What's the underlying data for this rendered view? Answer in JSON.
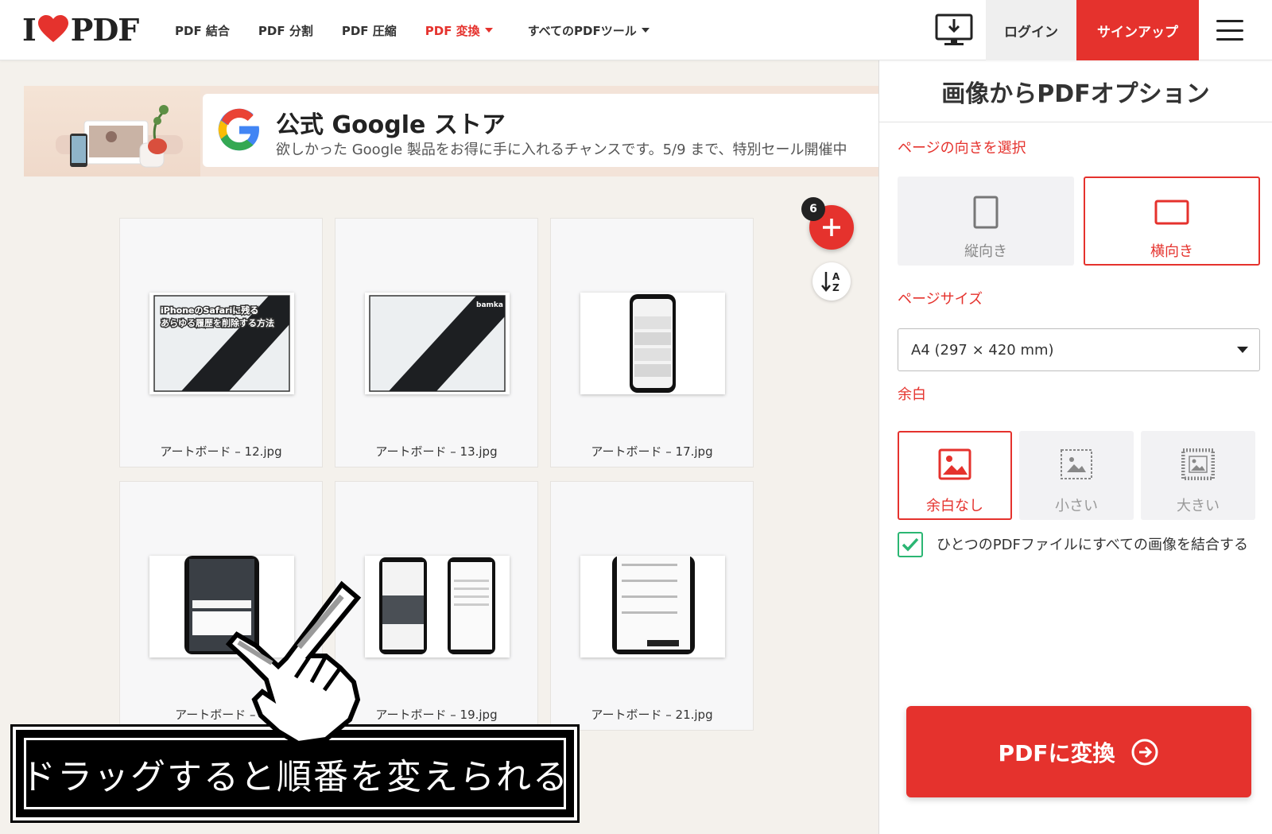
{
  "header": {
    "logo_text": "PDF",
    "logo_prefix": "I",
    "nav": [
      {
        "label": "PDF 結合",
        "active": false,
        "dropdown": false
      },
      {
        "label": "PDF 分割",
        "active": false,
        "dropdown": false
      },
      {
        "label": "PDF 圧縮",
        "active": false,
        "dropdown": false
      },
      {
        "label": "PDF 変換",
        "active": true,
        "dropdown": true
      },
      {
        "label": "すべてのPDFツール",
        "active": false,
        "dropdown": true
      }
    ],
    "desktop_icon": "desktop-download-icon",
    "login_label": "ログイン",
    "signup_label": "サインアップ",
    "menu_icon": "hamburger-menu-icon"
  },
  "ad": {
    "title": "公式 Google ストア",
    "subtitle": "欲しかった Google 製品をお得に手に入れるチャンスです。5/9 まで、特別セール開催中"
  },
  "files": [
    {
      "name": "アートボード – 12.jpg",
      "thumb_text": "iPhoneのSafariに残る\nあらゆる履歴を削除する方法"
    },
    {
      "name": "アートボード – 13.jpg",
      "thumb_text": "bamka"
    },
    {
      "name": "アートボード – 17.jpg"
    },
    {
      "name": "アートボード – 1"
    },
    {
      "name": "アートボード – 19.jpg"
    },
    {
      "name": "アートボード – 21.jpg"
    }
  ],
  "file_count": "6",
  "sort_icon": "sort-az-icon",
  "sidebar": {
    "title": "画像からPDFオプション",
    "orientation_label": "ページの向きを選択",
    "orientation_options": [
      {
        "label": "縦向き",
        "selected": false
      },
      {
        "label": "横向き",
        "selected": true
      }
    ],
    "page_size_label": "ページサイズ",
    "page_size_value": "A4 (297 × 420 mm)",
    "margin_label": "余白",
    "margin_options": [
      {
        "label": "余白なし",
        "selected": true
      },
      {
        "label": "小さい",
        "selected": false
      },
      {
        "label": "大きい",
        "selected": false
      }
    ],
    "merge_checked": true,
    "merge_label": "ひとつのPDFファイルにすべての画像を結合する",
    "convert_label": "PDFに変換"
  },
  "annotation": {
    "caption": "ドラッグすると順番を変えられる"
  },
  "colors": {
    "brand_red": "#e5322d",
    "check_green": "#2bb673"
  }
}
